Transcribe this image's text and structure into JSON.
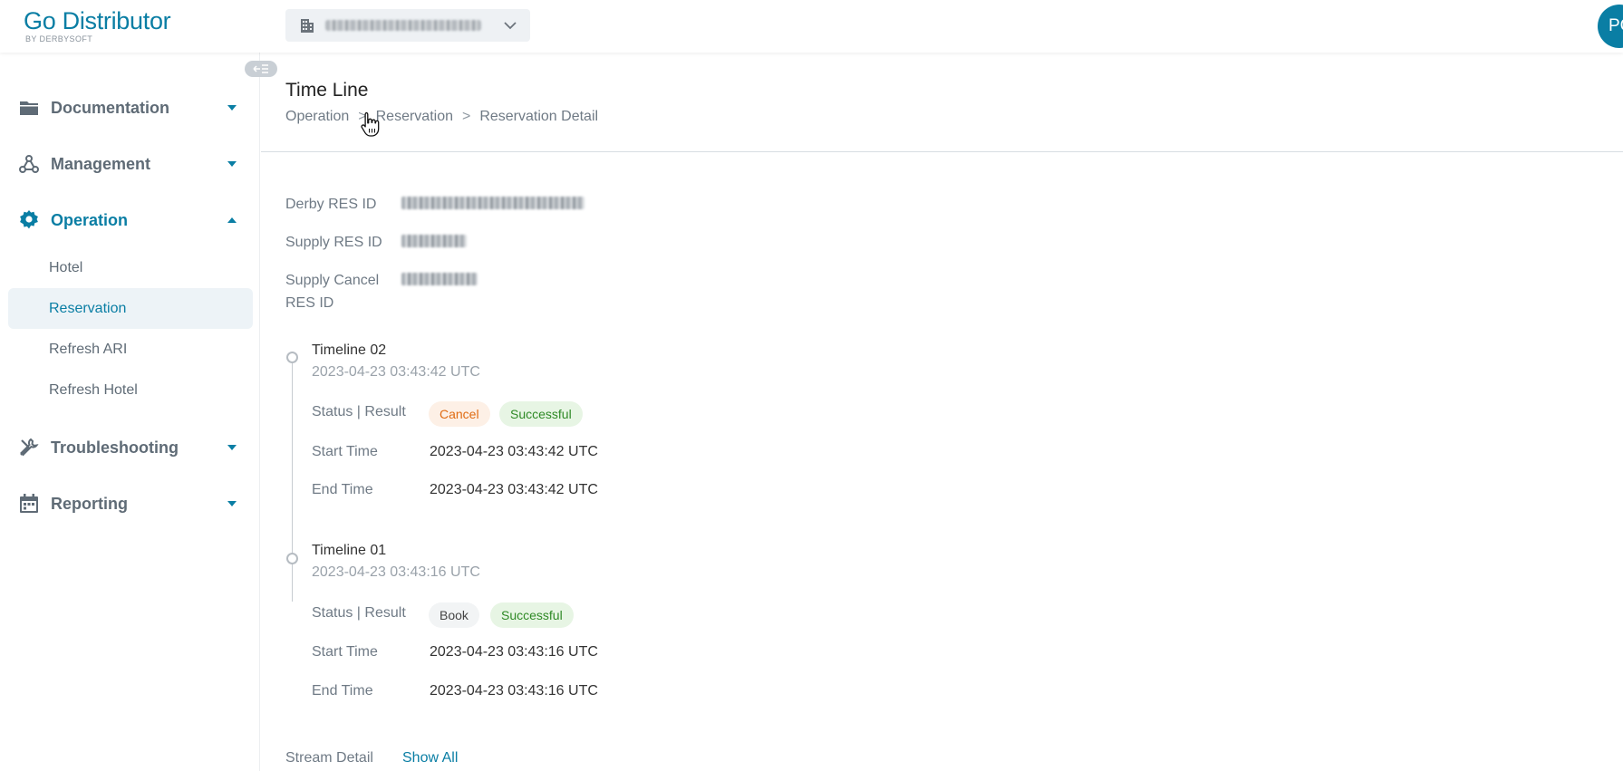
{
  "app": {
    "logo_title": "Go Distributor",
    "logo_sub": "BY DERBYSOFT",
    "brand_color": "#0a7ea4"
  },
  "header": {
    "hotel_selector_value": "",
    "avatar_initials": "PC"
  },
  "sidebar": {
    "groups": [
      {
        "label": "Documentation",
        "icon": "folder-icon",
        "expanded": false
      },
      {
        "label": "Management",
        "icon": "network-icon",
        "expanded": false
      },
      {
        "label": "Operation",
        "icon": "gear-icon",
        "expanded": true
      },
      {
        "label": "Troubleshooting",
        "icon": "wrench-icon",
        "expanded": false
      },
      {
        "label": "Reporting",
        "icon": "calendar-icon",
        "expanded": false
      }
    ],
    "operation_items": [
      {
        "label": "Hotel"
      },
      {
        "label": "Reservation",
        "selected": true
      },
      {
        "label": "Refresh ARI"
      },
      {
        "label": "Refresh Hotel"
      }
    ]
  },
  "page": {
    "title": "Time Line",
    "breadcrumb": [
      "Operation",
      "Reservation",
      "Reservation Detail"
    ],
    "breadcrumb_sep": ">"
  },
  "details": {
    "derby_res_id_label": "Derby RES ID",
    "supply_res_id_label": "Supply RES ID",
    "supply_cancel_label_1": "Supply Cancel",
    "supply_cancel_label_2": "RES ID"
  },
  "timeline": [
    {
      "title": "Timeline 02",
      "time": "2023-04-23 03:43:42 UTC",
      "status_label": "Status | Result",
      "status": "Cancel",
      "result": "Successful",
      "start_label": "Start Time",
      "start": "2023-04-23 03:43:42 UTC",
      "end_label": "End Time",
      "end": "2023-04-23 03:43:42 UTC"
    },
    {
      "title": "Timeline 01",
      "time": "2023-04-23 03:43:16 UTC",
      "status_label": "Status | Result",
      "status": "Book",
      "result": "Successful",
      "start_label": "Start Time",
      "start": "2023-04-23 03:43:16 UTC",
      "end_label": "End Time",
      "end": "2023-04-23 03:43:16 UTC"
    }
  ],
  "stream": {
    "label": "Stream Detail",
    "show_all": "Show All"
  }
}
